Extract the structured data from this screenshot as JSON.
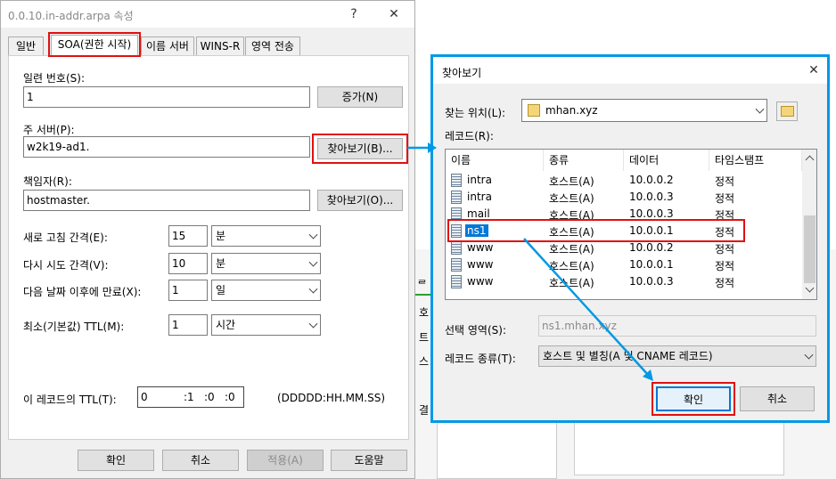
{
  "soa_dialog": {
    "title": "0.0.10.in-addr.arpa 속성",
    "help_glyph": "?",
    "close_glyph": "✕",
    "tabs": [
      "일반",
      "SOA(권한 시작)",
      "이름 서버",
      "WINS-R",
      "영역 전송"
    ],
    "serial_label": "일련 번호(S):",
    "serial_value": "1",
    "increment_button": "증가(N)",
    "primary_label": "주 서버(P):",
    "primary_value": "w2k19-ad1.",
    "browse_button_1": "찾아보기(B)...",
    "responsible_label": "책임자(R):",
    "responsible_value": "hostmaster.",
    "browse_button_2": "찾아보기(O)...",
    "refresh_label": "새로 고침 간격(E):",
    "refresh_value": "15",
    "refresh_unit": "분",
    "retry_label": "다시 시도 간격(V):",
    "retry_value": "10",
    "retry_unit": "분",
    "expire_label": "다음 날짜 이후에 만료(X):",
    "expire_value": "1",
    "expire_unit": "일",
    "minttl_label": "최소(기본값) TTL(M):",
    "minttl_value": "1",
    "minttl_unit": "시간",
    "record_ttl_label": "이 레코드의 TTL(T):",
    "ttl_days": "0",
    "ttl_hours": ":1",
    "ttl_minutes": ":0",
    "ttl_seconds": ":0",
    "ttl_format": "(DDDDD:HH.MM.SS)",
    "ok_button": "확인",
    "cancel_button": "취소",
    "apply_button": "적용(A)",
    "help_button": "도움말"
  },
  "browse_dialog": {
    "title": "찾아보기",
    "close_glyph": "✕",
    "look_in_label": "찾는 위치(L):",
    "look_in_value": "mhan.xyz",
    "records_label": "레코드(R):",
    "columns": [
      "이름",
      "종류",
      "데이터",
      "타임스탬프"
    ],
    "rows": [
      {
        "name": "intra",
        "type": "호스트(A)",
        "data": "10.0.0.2",
        "timestamp": "정적"
      },
      {
        "name": "intra",
        "type": "호스트(A)",
        "data": "10.0.0.3",
        "timestamp": "정적"
      },
      {
        "name": "mail",
        "type": "호스트(A)",
        "data": "10.0.0.3",
        "timestamp": "정적"
      },
      {
        "name": "ns1",
        "type": "호스트(A)",
        "data": "10.0.0.1",
        "timestamp": "정적"
      },
      {
        "name": "www",
        "type": "호스트(A)",
        "data": "10.0.0.2",
        "timestamp": "정적"
      },
      {
        "name": "www",
        "type": "호스트(A)",
        "data": "10.0.0.1",
        "timestamp": "정적"
      },
      {
        "name": "www",
        "type": "호스트(A)",
        "data": "10.0.0.3",
        "timestamp": "정적"
      }
    ],
    "selected_row": "ns1",
    "selection_label": "선택 영역(S):",
    "selection_value": "ns1.mhan.xyz",
    "record_type_label": "레코드 종류(T):",
    "record_type_value": "호스트 및 별칭(A 및 CNAME 레코드)",
    "ok_button": "확인",
    "cancel_button": "취소"
  },
  "background_fragments": [
    "ᆯ 서",
    "호",
    "트",
    "스",
    "결"
  ],
  "colors": {
    "highlight_red": "#e01010",
    "accent_blue": "#0099e5",
    "selection_blue": "#0078d7"
  }
}
